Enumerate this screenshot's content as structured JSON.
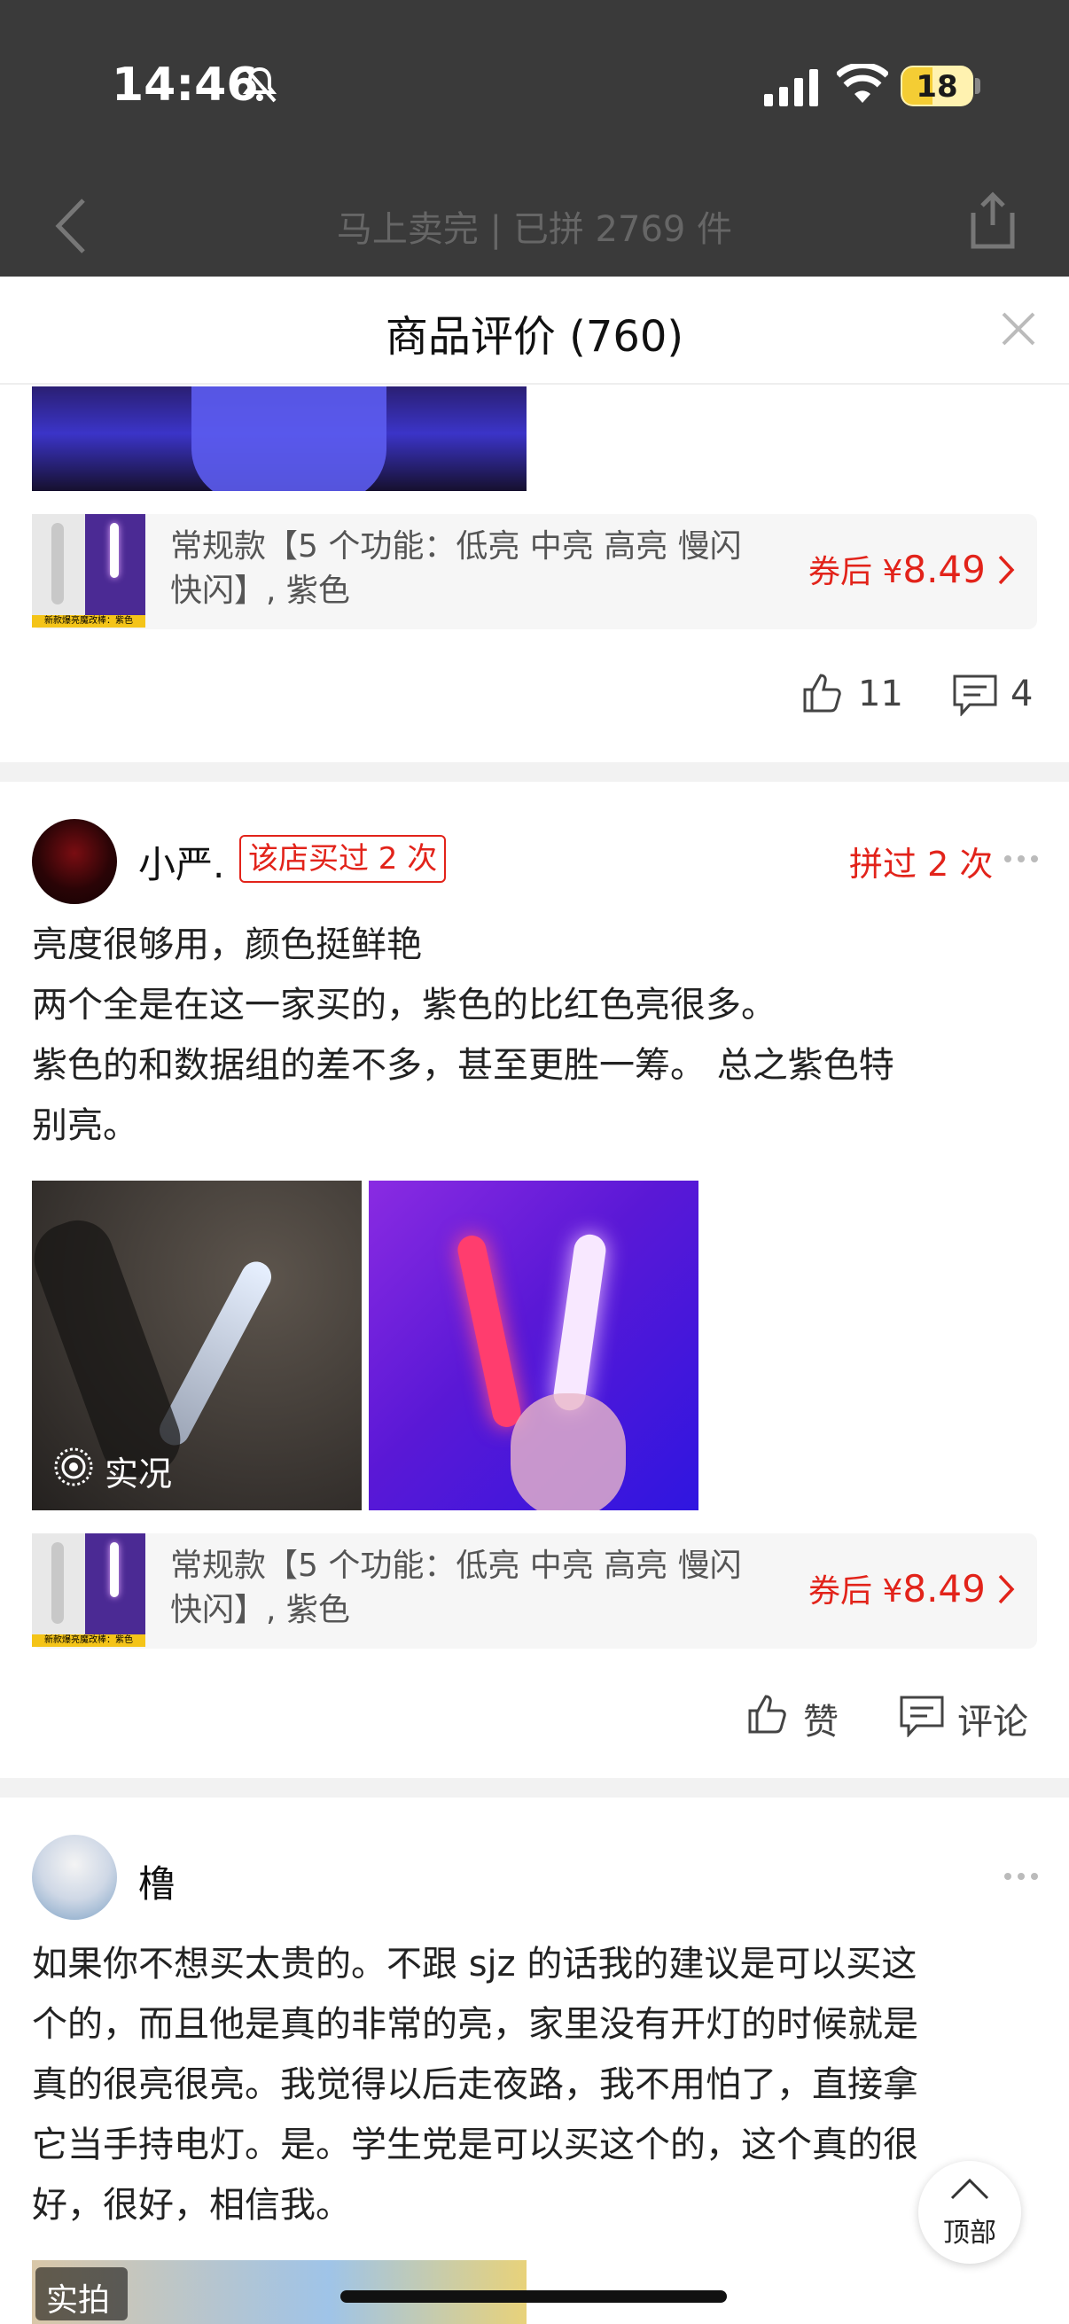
{
  "status_bar": {
    "time": "14:46",
    "battery": "18"
  },
  "background_page": {
    "title": "马上卖完 | 已拼 2769 件"
  },
  "sheet": {
    "title": "商品评价 (760)"
  },
  "sku": {
    "text": "常规款【5 个功能：低亮 中亮 高亮 慢闪快闪】, 紫色",
    "line1": "常规款【5 个功能：低亮 中亮 高亮 慢闪",
    "line2": "快闪】, 紫色",
    "price_prefix": "券后 ¥",
    "price": "8.49",
    "thumb_tag": "新款爆亮魔改棒：紫色"
  },
  "reviews": [
    {
      "likes": "11",
      "comments": "4"
    },
    {
      "username": "小严.",
      "store_badge": "该店买过 2 次",
      "group_badge": "拼过 2 次",
      "text_lines": [
        "亮度很够用，颜色挺鲜艳",
        "两个全是在这一家买的，紫色的比红色亮很多。",
        "紫色的和数据组的差不多，甚至更胜一筹。  总之紫色特",
        "别亮。"
      ],
      "live_label": "实况",
      "like_label": "赞",
      "comment_label": "评论"
    },
    {
      "username": "橹",
      "text_lines": [
        "如果你不想买太贵的。不跟 sjz 的话我的建议是可以买这",
        "个的，而且他是真的非常的亮，家里没有开灯的时候就是",
        "真的很亮很亮。我觉得以后走夜路，我不用怕了，直接拿",
        "它当手持电灯。是。学生党是可以买这个的，这个真的很",
        "好，很好，相信我。"
      ],
      "photo_tag": "实拍"
    }
  ],
  "back_to_top": "顶部"
}
